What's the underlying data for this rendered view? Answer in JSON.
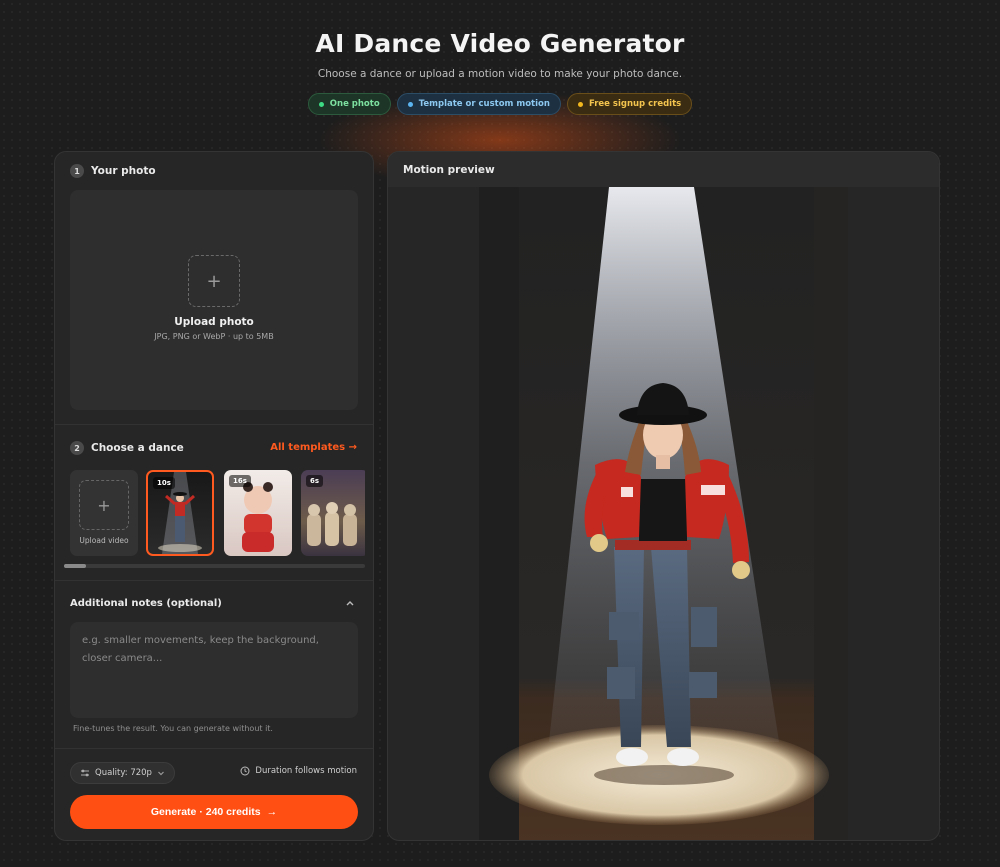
{
  "hero": {
    "title": "AI Dance Video Generator",
    "subtitle": "Choose a dance or upload a motion video to make your photo dance.",
    "chips": [
      {
        "label": "One photo",
        "color": "#3ddc84"
      },
      {
        "label": "Template or custom motion",
        "color": "#5bb4f0"
      },
      {
        "label": "Free signup credits",
        "color": "#f3b81e"
      }
    ]
  },
  "left": {
    "step1": {
      "number": "1",
      "title": "Your photo"
    },
    "upload": {
      "title": "Upload photo",
      "hint": "JPG, PNG or WebP · up to 5MB"
    },
    "step2": {
      "number": "2",
      "title": "Choose a dance",
      "all_templates": "All templates →"
    },
    "templates": [
      {
        "label": "Upload video"
      },
      {
        "duration": "10s",
        "selected": true
      },
      {
        "duration": "16s"
      },
      {
        "duration": "6s"
      }
    ],
    "notes": {
      "title": "Additional notes (optional)",
      "placeholder": "e.g. smaller movements, keep the background, closer camera...",
      "help": "Fine-tunes the result. You can generate without it."
    },
    "quality": "Quality: 720p",
    "duration": "Duration follows motion",
    "generate": "Generate · 240 credits"
  },
  "right": {
    "title": "Motion preview"
  },
  "colors": {
    "accent": "#ff4f12",
    "panel": "#262626",
    "background": "#1d1d1d"
  }
}
